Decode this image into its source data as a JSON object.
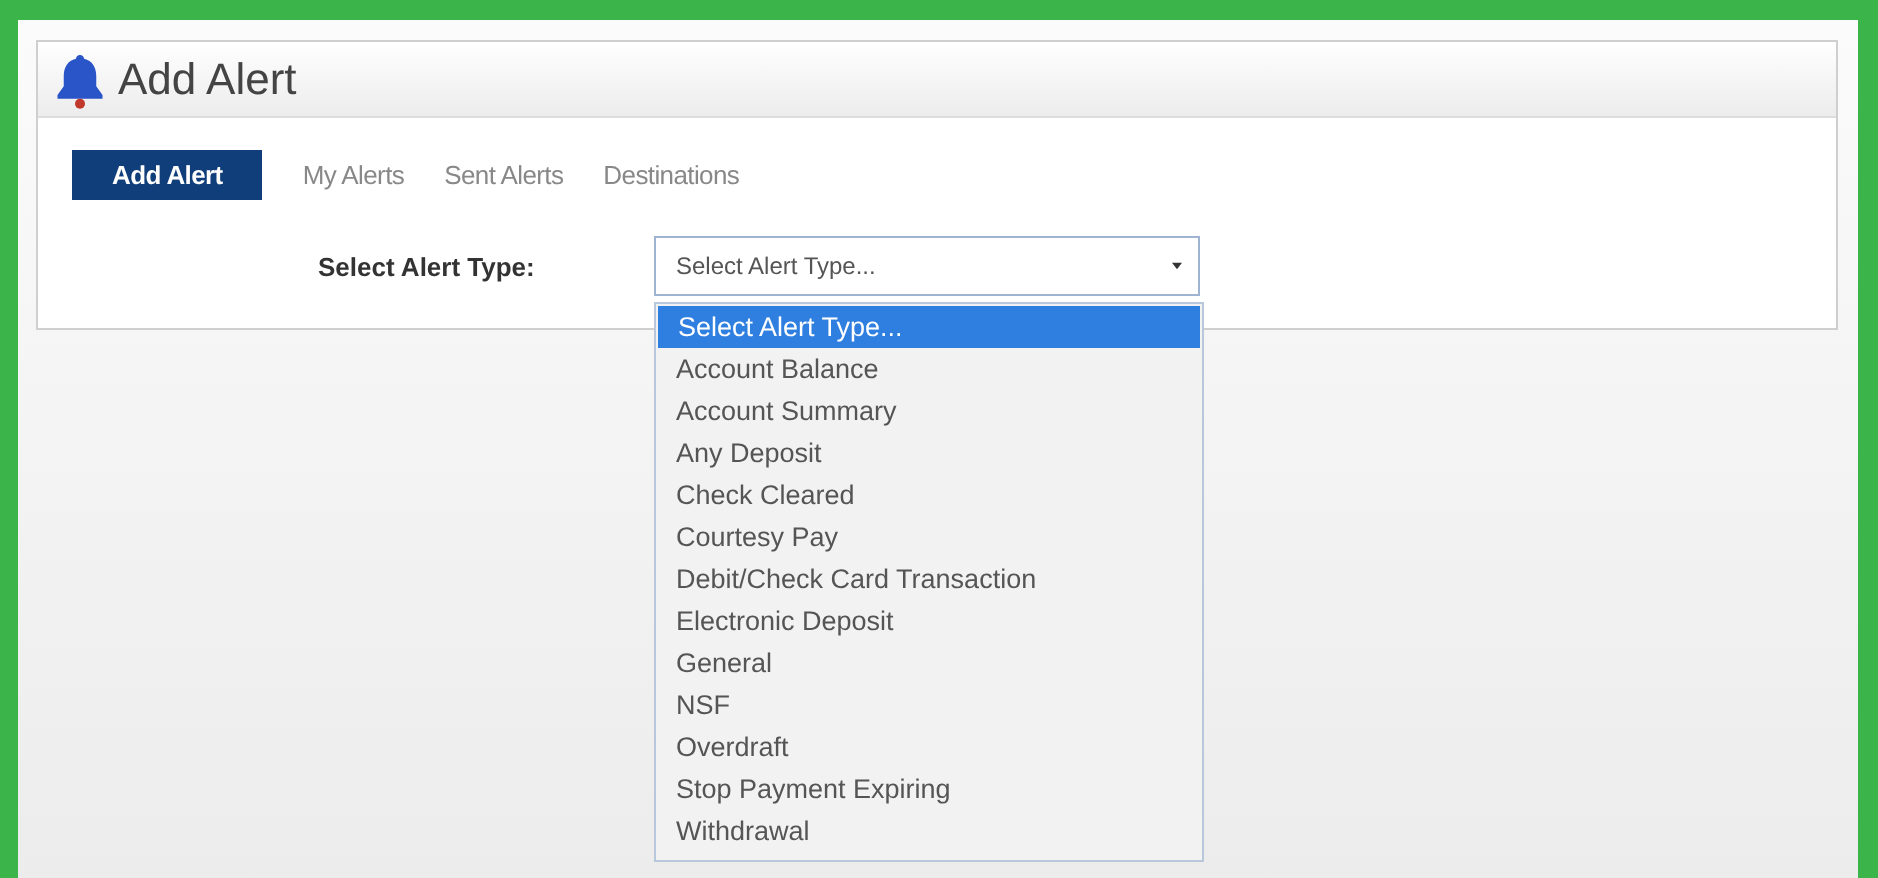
{
  "panel": {
    "title": "Add Alert"
  },
  "tabs": [
    {
      "label": "Add Alert",
      "selected": true
    },
    {
      "label": "My Alerts",
      "selected": false
    },
    {
      "label": "Sent Alerts",
      "selected": false
    },
    {
      "label": "Destinations",
      "selected": false
    }
  ],
  "alert_type": {
    "label": "Select Alert Type:",
    "value": "Select Alert Type...",
    "expanded": true,
    "options": [
      {
        "label": "Select Alert Type...",
        "selected": true
      },
      {
        "label": "Account Balance",
        "selected": false
      },
      {
        "label": "Account Summary",
        "selected": false
      },
      {
        "label": "Any Deposit",
        "selected": false
      },
      {
        "label": "Check Cleared",
        "selected": false
      },
      {
        "label": "Courtesy Pay",
        "selected": false
      },
      {
        "label": "Debit/Check Card Transaction",
        "selected": false
      },
      {
        "label": "Electronic Deposit",
        "selected": false
      },
      {
        "label": "General",
        "selected": false
      },
      {
        "label": "NSF",
        "selected": false
      },
      {
        "label": "Overdraft",
        "selected": false
      },
      {
        "label": "Stop Payment Expiring",
        "selected": false
      },
      {
        "label": "Withdrawal",
        "selected": false
      }
    ]
  }
}
